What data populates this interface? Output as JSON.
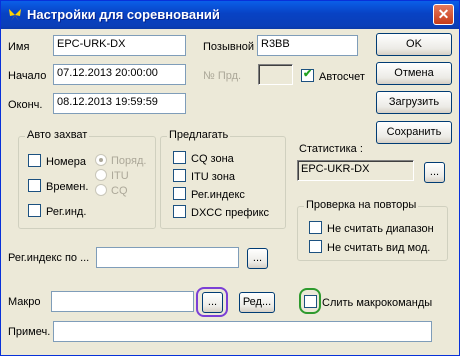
{
  "window": {
    "title": "Настройки для соревнований",
    "close_label": "✕"
  },
  "form": {
    "name_label": "Имя",
    "name_value": "EPC-URK-DX",
    "callsign_label": "Позывной",
    "callsign_value": "R3BB",
    "start_label": "Начало",
    "start_value": "07.12.2013 20:00:00",
    "end_label": "Оконч.",
    "end_value": "08.12.2013 19:59:59",
    "prev_no_label": "№ Прд.",
    "prev_no_value": "",
    "autocount_label": "Автосчет",
    "autocount_checked": true
  },
  "buttons": {
    "ok": "OK",
    "cancel": "Отмена",
    "load": "Загрузить",
    "save": "Сохранить"
  },
  "auto_capture": {
    "title": "Авто захват",
    "checks": [
      "Номера",
      "Времен.",
      "Рег.инд."
    ],
    "radios": [
      "Поряд.",
      "ITU",
      "CQ"
    ],
    "selected_radio": "Поряд."
  },
  "suggest": {
    "title": "Предлагать",
    "checks": [
      "CQ зона",
      "ITU зона",
      "Рег.индекс",
      "DXCC префикс"
    ]
  },
  "statistics": {
    "label": "Статистика :",
    "value": "EPC-UKR-DX",
    "browse_label": "..."
  },
  "repeat_check": {
    "title": "Проверка на повторы",
    "checks": [
      "Не считать диапазон",
      "Не считать вид мод."
    ]
  },
  "regindex": {
    "label": "Рег.индекс по ...",
    "value": "",
    "browse_label": "..."
  },
  "macro": {
    "label": "Макро",
    "value": "",
    "browse_label": "...",
    "edit_label": "Ред...",
    "merge_label": "Слить макрокоманды",
    "merge_checked": false
  },
  "note": {
    "label": "Примеч.",
    "value": ""
  },
  "highlights": {
    "purple": "#7b3fd6",
    "green": "#2e9a2e"
  }
}
